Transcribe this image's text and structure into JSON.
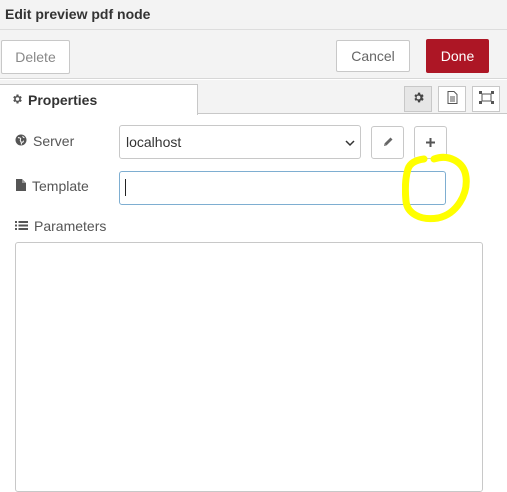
{
  "dialog": {
    "title": "Edit preview pdf node"
  },
  "toolbar": {
    "delete_label": "Delete",
    "cancel_label": "Cancel",
    "done_label": "Done"
  },
  "tabs": {
    "properties_label": "Properties",
    "icons": [
      "gear-icon",
      "file-text-icon",
      "appearance-frame-icon"
    ]
  },
  "form": {
    "server": {
      "label": "Server",
      "value": "localhost"
    },
    "template": {
      "label": "Template",
      "value": ""
    },
    "parameters": {
      "label": "Parameters",
      "value": ""
    }
  },
  "colors": {
    "done_button": "#ad1625",
    "focus_border": "#7eaed1",
    "highlight_marker": "#ffff00",
    "panel_background": "#f3f3f3"
  }
}
